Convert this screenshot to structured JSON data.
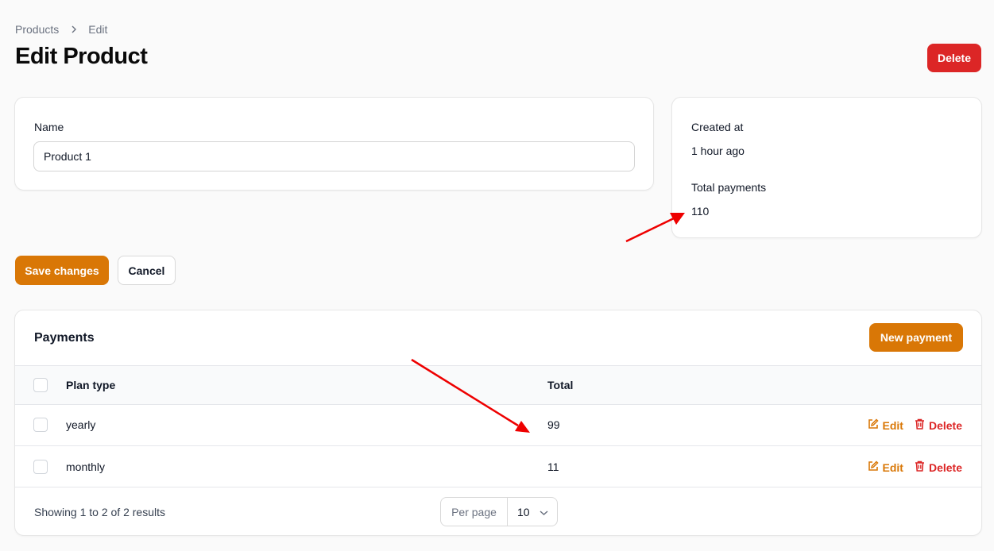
{
  "breadcrumb": {
    "root": "Products",
    "current": "Edit"
  },
  "page": {
    "title": "Edit Product",
    "delete_label": "Delete"
  },
  "form": {
    "name_label": "Name",
    "name_value": "Product 1"
  },
  "info": {
    "created_label": "Created at",
    "created_value": "1 hour ago",
    "payments_label": "Total payments",
    "payments_value": "110"
  },
  "actions": {
    "save_label": "Save changes",
    "cancel_label": "Cancel"
  },
  "payments": {
    "title": "Payments",
    "new_label": "New payment",
    "columns": [
      "Plan type",
      "Total"
    ],
    "rows": [
      {
        "plan": "yearly",
        "total": "99"
      },
      {
        "plan": "monthly",
        "total": "11"
      }
    ],
    "edit_label": "Edit",
    "delete_label": "Delete",
    "footer": "Showing 1 to 2 of 2 results",
    "per_page_label": "Per page",
    "per_page_value": "10"
  },
  "colors": {
    "primary": "#d97706",
    "danger": "#dc2626",
    "annotation": "#ee0000"
  },
  "icons": [
    "chevron-right-icon",
    "edit-icon",
    "trash-icon",
    "chevron-down-icon"
  ]
}
